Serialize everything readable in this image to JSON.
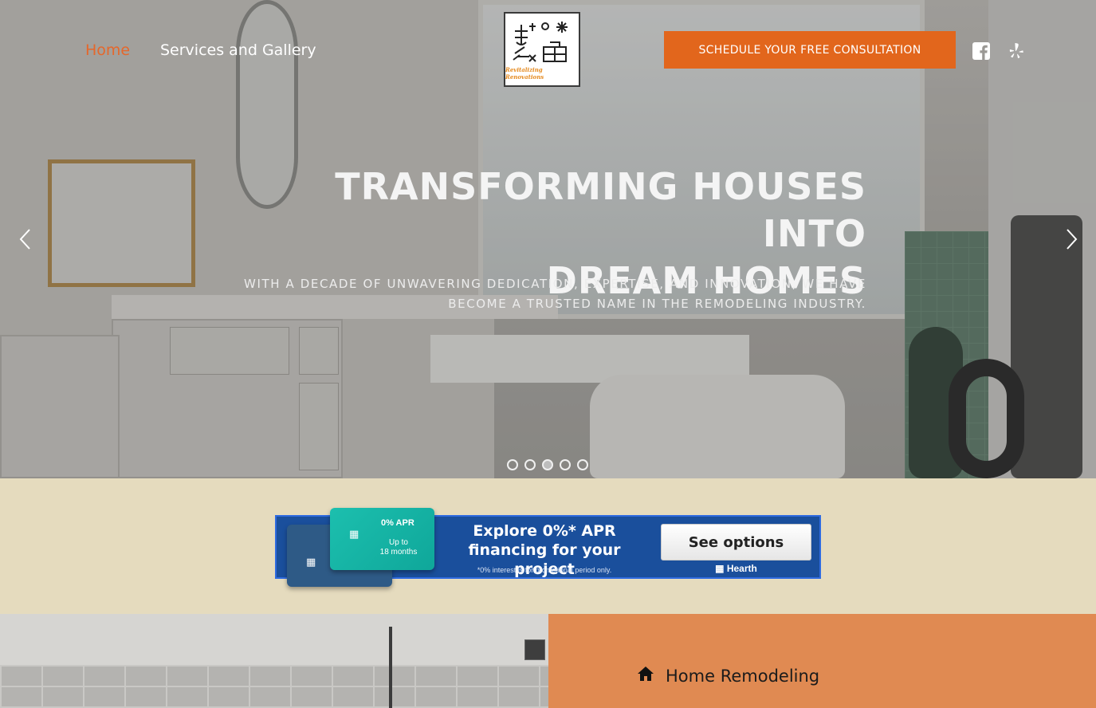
{
  "nav": {
    "home_label": "Home",
    "services_label": "Services and Gallery"
  },
  "logo": {
    "text": "Revitalizing Renovations"
  },
  "cta": {
    "label": "SCHEDULE YOUR FREE CONSULTATION"
  },
  "social": [
    {
      "icon": "facebook-icon"
    },
    {
      "icon": "yelp-icon"
    }
  ],
  "hero": {
    "title_line1": "TRANSFORMING HOUSES INTO",
    "title_line2": "DREAM HOMES",
    "subtitle_line1": "WITH A DECADE OF UNWAVERING DEDICATION, EXPERTISE, AND INNOVATION, WE HAVE",
    "subtitle_line2": "BECOME A TRUSTED NAME IN THE REMODELING INDUSTRY.",
    "slide_count": 5,
    "active_slide": 3
  },
  "financing": {
    "apr": "0% APR",
    "up_to": "Up to",
    "months": "18 months",
    "headline_line1": "Explore 0%* APR",
    "headline_line2": "financing for your project",
    "fine_print": "*0% interest is for promotional period only.",
    "button_label": "See options",
    "brand": "Hearth"
  },
  "services": {
    "first_label": "Home Remodeling",
    "first_icon": "home-icon"
  },
  "colors": {
    "accent": "#e2661c",
    "band": "#e5dbbe",
    "banner": "#1a4f9c",
    "services_bg": "#e08a52"
  }
}
